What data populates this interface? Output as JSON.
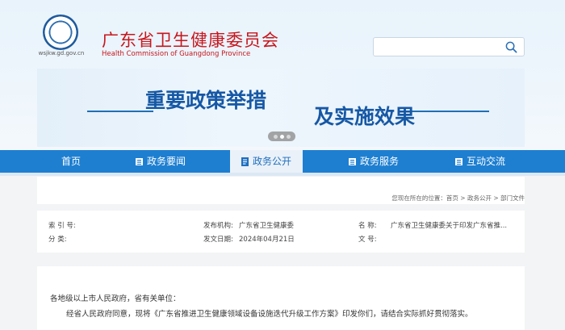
{
  "header": {
    "site_name_cn": "广东省卫生健康委员会",
    "site_name_en": "Health Commission of Guangdong Province",
    "domain": "wsjkw.gd.gov.cn",
    "search": {
      "placeholder": ""
    }
  },
  "banner": {
    "title_part1": "重要政策举措",
    "title_part2": "及实施效果",
    "slides": 3,
    "active_slide": 2
  },
  "nav": {
    "items": [
      {
        "label": "首页",
        "icon": ""
      },
      {
        "label": "政务要闻",
        "icon": "grid-icon"
      },
      {
        "label": "政务公开",
        "icon": "document-icon",
        "active": true
      },
      {
        "label": "政务服务",
        "icon": "grid-icon"
      },
      {
        "label": "互动交流",
        "icon": "grid-icon"
      }
    ]
  },
  "breadcrumb": "您现在所在的位置：首页 > 政务公开 > 部门文件",
  "info": {
    "index_label": "索 引 号:",
    "index_value": "",
    "category_label": "分    类:",
    "category_value": "",
    "publisher_label": "发布机构:",
    "publisher_value": "广东省卫生健康委",
    "date_label": "发文日期:",
    "date_value": "2024年04月21日",
    "name_label": "名      称:",
    "name_value": "广东省卫生健康委关于印发广东省推...",
    "docno_label": "文      号:",
    "docno_value": ""
  },
  "body": {
    "salutation": "各地级以上市人民政府，省有关单位：",
    "paragraph1": "经省人民政府同意，现将《广东省推进卫生健康领域设备设施迭代升级工作方案》印发你们，请结合实际抓好贯彻落实。"
  },
  "colors": {
    "brand_red": "#c8161d",
    "nav_blue": "#1e7fd1",
    "banner_blue": "#1658a5"
  }
}
